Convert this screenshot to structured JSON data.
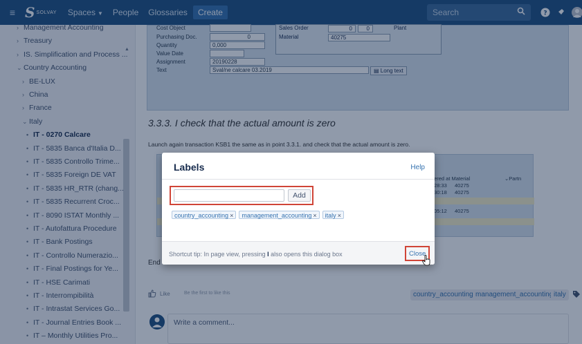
{
  "topbar": {
    "logo_text": "SOLVAY",
    "spaces_label": "Spaces",
    "people_label": "People",
    "glossaries_label": "Glossaries",
    "create_label": "Create",
    "search_placeholder": "Search"
  },
  "sidebar": {
    "items": [
      {
        "label": "Management Accounting",
        "glyph": "›"
      },
      {
        "label": "Treasury",
        "glyph": "›"
      },
      {
        "label": "IS. Simplification and Process ...",
        "glyph": "›"
      },
      {
        "label": "Country Accounting",
        "glyph": "⌄"
      },
      {
        "label": "BE-LUX",
        "glyph": "›"
      },
      {
        "label": "China",
        "glyph": "›"
      },
      {
        "label": "France",
        "glyph": "›"
      },
      {
        "label": "Italy",
        "glyph": "⌄"
      },
      {
        "label": "IT - 0270 Calcare",
        "glyph": "•"
      },
      {
        "label": "IT - 5835 Banca d'Italia D...",
        "glyph": "•"
      },
      {
        "label": "IT - 5835 Controllo Trime...",
        "glyph": "•"
      },
      {
        "label": "IT - 5835 Foreign DE VAT",
        "glyph": "•"
      },
      {
        "label": "IT - 5835 HR_RTR (chang...",
        "glyph": "•"
      },
      {
        "label": "IT - 5835 Recurrent Croc...",
        "glyph": "•"
      },
      {
        "label": "IT - 8090 ISTAT Monthly ...",
        "glyph": "•"
      },
      {
        "label": "IT - Autofattura Procedure",
        "glyph": "•"
      },
      {
        "label": "IT - Bank Postings",
        "glyph": "•"
      },
      {
        "label": "IT - Controllo Numerazio...",
        "glyph": "•"
      },
      {
        "label": "IT - Final Postings for Ye...",
        "glyph": "•"
      },
      {
        "label": "IT - HSE Carimati",
        "glyph": "•"
      },
      {
        "label": "IT - Interrompibilità",
        "glyph": "•"
      },
      {
        "label": "IT - Intrastat Services Go...",
        "glyph": "•"
      },
      {
        "label": "IT - Journal Entries Book ...",
        "glyph": "•"
      },
      {
        "label": "IT – Monthly Utilities Pro...",
        "glyph": "•"
      }
    ]
  },
  "sap_form": {
    "cost_object_label": "Cost Object",
    "purchasing_doc_label": "Purchasing Doc.",
    "purchasing_doc_value": "0",
    "quantity_label": "Quantity",
    "quantity_value": "0,000",
    "value_date_label": "Value Date",
    "assignment_label": "Assignment",
    "assignment_value": "20190228",
    "text_label": "Text",
    "text_value": "Sval/ne calcare 03.2019",
    "sales_order_label": "Sales Order",
    "sales_order_v1": "0",
    "sales_order_v2": "0",
    "plant_label": "Plant",
    "material_label": "Material",
    "material_value": "40275",
    "long_text_label": "Long text"
  },
  "content": {
    "heading": "3.3.3. I check that the actual amount is zero",
    "paragraph": "Launch again transaction KSB1 the same as in point 3.3.1. and check that the actual amount is zero.",
    "end_text": "End of document",
    "sap2_header": "tered at Material",
    "sap2_header2": "Partn",
    "sap2_rows": [
      {
        "time": ":28:33",
        "mat": "40275"
      },
      {
        "time": ":30:18",
        "mat": "40275"
      },
      {
        "time": ":05:12",
        "mat": "40275"
      }
    ],
    "like_label": "Like",
    "first_like": "Be the first to like this",
    "page_labels": [
      "country_accounting",
      "management_accounting",
      "italy"
    ],
    "comment_placeholder": "Write a comment..."
  },
  "dialog": {
    "title": "Labels",
    "help": "Help",
    "input_value": "",
    "add_button": "Add",
    "labels": [
      "country_accounting",
      "management_accounting",
      "italy"
    ],
    "remove_glyph": "×",
    "tip_prefix": "Shortcut tip: In page view, pressing ",
    "tip_key": "l",
    "tip_suffix": " also opens this dialog box",
    "close": "Close"
  },
  "colors": {
    "header": "#205081",
    "link": "#3572b0",
    "highlight": "#d04437"
  }
}
